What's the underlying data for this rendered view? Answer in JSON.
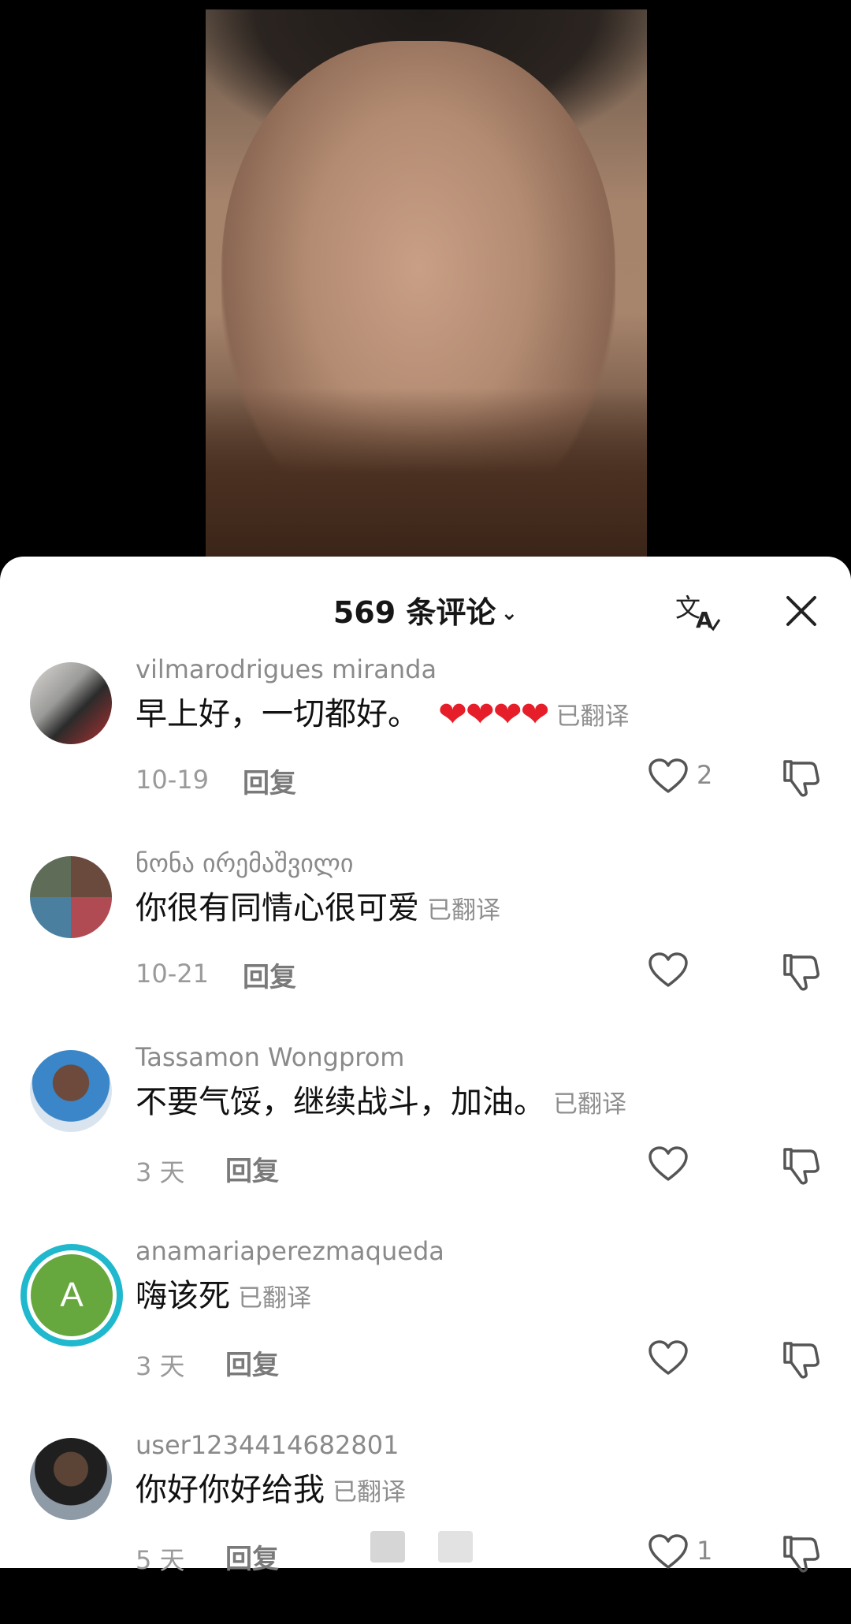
{
  "header": {
    "title": "569 条评论",
    "chevron": "⌄",
    "translate_icon": "translate-icon",
    "close_icon": "close-icon"
  },
  "translated_label": "已翻译",
  "reply_label": "回复",
  "colors": {
    "avatar_ring": "#1fb8cd",
    "avatar_letter_bg": "#66a83d",
    "heart_emoji": "#e61e2a"
  },
  "comments": [
    {
      "username": "vilmarodrigues miranda",
      "text": "早上好，一切都好。",
      "emoji": "❤❤❤❤",
      "date": "10-19",
      "likes": "2"
    },
    {
      "username": "ნონა ირემაშვილი",
      "text": "你很有同情心很可爱",
      "date": "10-21",
      "likes": ""
    },
    {
      "username": "Tassamon Wongprom",
      "text": "不要气馁，继续战斗，加油。",
      "date": "3 天",
      "likes": ""
    },
    {
      "username": "anamariaperezmaqueda",
      "avatar_letter": "A",
      "text": "嗨该死",
      "date": "3 天",
      "likes": ""
    },
    {
      "username": "user1234414682801",
      "text": "你好你好给我",
      "date": "5 天",
      "likes": "1"
    }
  ]
}
